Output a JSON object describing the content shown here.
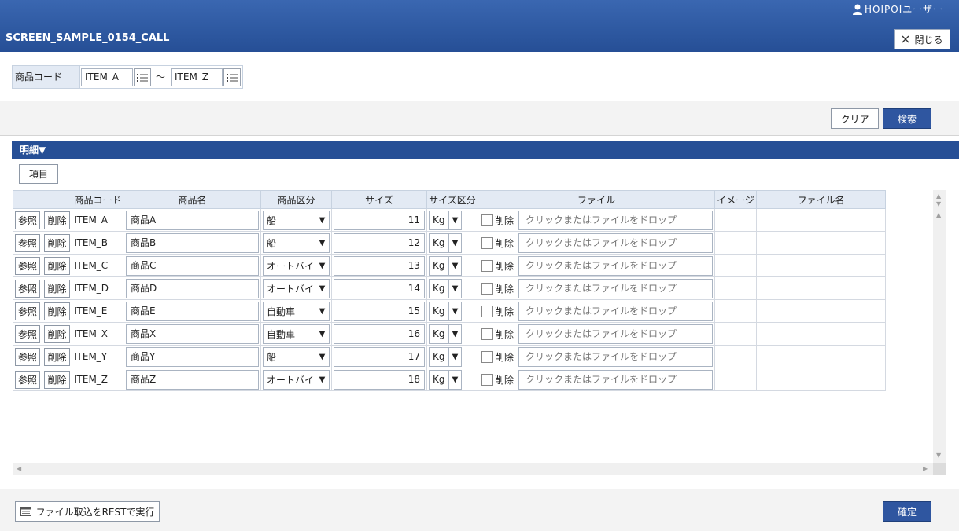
{
  "header": {
    "user_name": "HOIPOIユーザー",
    "screen_title": "SCREEN_SAMPLE_0154_CALL",
    "close_label": "閉じる"
  },
  "search": {
    "label": "商品コード",
    "from_value": "ITEM_A",
    "tilde": "～",
    "to_value": "ITEM_Z"
  },
  "actions": {
    "clear_label": "クリア",
    "search_label": "検索"
  },
  "detail": {
    "section_title": "明細▼",
    "items_button_label": "項目",
    "columns": [
      "",
      "",
      "商品コード",
      "商品名",
      "商品区分",
      "サイズ",
      "サイズ区分",
      "ファイル",
      "イメージ",
      "ファイル名"
    ],
    "ref_label": "参照",
    "delete_label": "削除",
    "file_delete_label": "削除",
    "drop_placeholder": "クリックまたはファイルをドロップ",
    "rows": [
      {
        "code": "ITEM_A",
        "name": "商品A",
        "category": "船",
        "size": "11",
        "unit": "Kg"
      },
      {
        "code": "ITEM_B",
        "name": "商品B",
        "category": "船",
        "size": "12",
        "unit": "Kg"
      },
      {
        "code": "ITEM_C",
        "name": "商品C",
        "category": "オートバイ",
        "size": "13",
        "unit": "Kg"
      },
      {
        "code": "ITEM_D",
        "name": "商品D",
        "category": "オートバイ",
        "size": "14",
        "unit": "Kg"
      },
      {
        "code": "ITEM_E",
        "name": "商品E",
        "category": "自動車",
        "size": "15",
        "unit": "Kg"
      },
      {
        "code": "ITEM_X",
        "name": "商品X",
        "category": "自動車",
        "size": "16",
        "unit": "Kg"
      },
      {
        "code": "ITEM_Y",
        "name": "商品Y",
        "category": "船",
        "size": "17",
        "unit": "Kg"
      },
      {
        "code": "ITEM_Z",
        "name": "商品Z",
        "category": "オートバイ",
        "size": "18",
        "unit": "Kg"
      }
    ]
  },
  "footer": {
    "rest_button_label": "ファイル取込をRESTで実行",
    "confirm_label": "確定"
  },
  "colors": {
    "header_blue": "#264f96",
    "primary_button": "#2f56a0",
    "grid_header_bg": "#e3eaf4"
  }
}
